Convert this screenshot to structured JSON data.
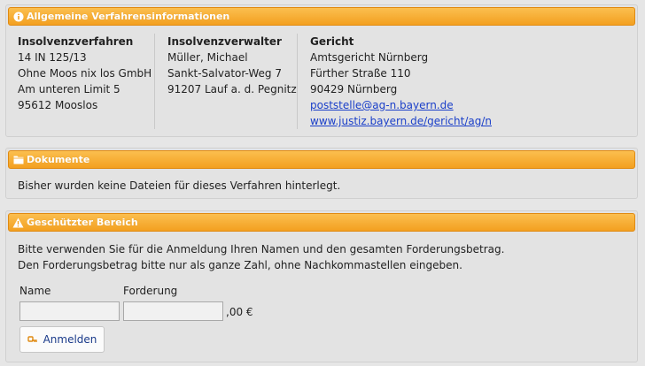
{
  "verfahren_panel": {
    "title": "Allgemeine Verfahrensinformationen",
    "insolvenzverfahren": {
      "header": "Insolvenzverfahren",
      "lines": [
        "14 IN 125/13",
        "Ohne Moos nix los GmbH",
        "Am unteren Limit 5",
        "95612 Mooslos"
      ]
    },
    "insolvenzverwalter": {
      "header": "Insolvenzverwalter",
      "lines": [
        "Müller, Michael",
        "Sankt-Salvator-Weg 7",
        "91207 Lauf a. d. Pegnitz"
      ]
    },
    "gericht": {
      "header": "Gericht",
      "lines": [
        "Amtsgericht Nürnberg",
        "Fürther Straße 110",
        "90429 Nürnberg"
      ],
      "email": "poststelle@ag-n.bayern.de",
      "website": "www.justiz.bayern.de/gericht/ag/n"
    }
  },
  "dokumente_panel": {
    "title": "Dokumente",
    "message": "Bisher wurden keine Dateien für dieses Verfahren hinterlegt."
  },
  "geschuetzt_panel": {
    "title": "Geschützter Bereich",
    "instruction_1": "Bitte verwenden Sie für die Anmeldung Ihren Namen und den gesamten Forderungsbetrag.",
    "instruction_2": "Den Forderungsbetrag bitte nur als ganze Zahl, ohne Nachkommastellen eingeben.",
    "name_label": "Name",
    "forderung_label": "Forderung",
    "name_value": "",
    "forderung_value": "",
    "currency_suffix": ",00 €",
    "login_button": "Anmelden"
  },
  "colors": {
    "header_orange": "#f3a020",
    "link_blue": "#1a3fc9",
    "button_text": "#1a3a8a"
  },
  "icons": {
    "verfahren": "info-circle-icon",
    "dokumente": "folder-icon",
    "geschuetzt": "warning-triangle-icon",
    "login": "key-icon"
  }
}
